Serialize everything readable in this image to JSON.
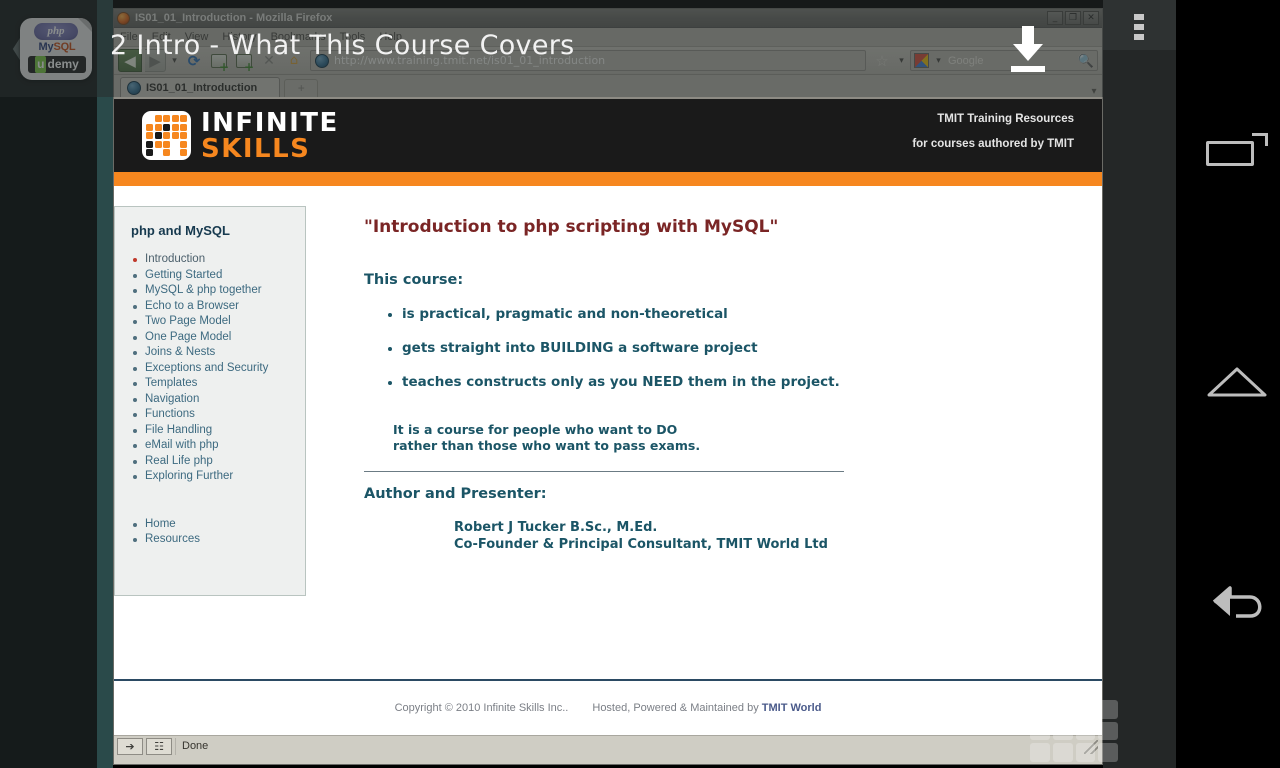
{
  "video_overlay": {
    "title": "2  Intro - What This Course Covers",
    "download_icon": "download-icon",
    "prev_chevron": "chevron-left-icon",
    "thumbnail": {
      "php": "php",
      "mysql_my": "My",
      "mysql_sql": "SQL",
      "udemy_u": "u",
      "udemy_rest": "demy"
    }
  },
  "browser": {
    "window_title": "IS01_01_Introduction - Mozilla Firefox",
    "window_buttons": {
      "minimize": "_",
      "maximize": "❐",
      "close": "✕"
    },
    "menu": [
      "File",
      "Edit",
      "View",
      "History",
      "Bookmarks",
      "Tools",
      "Help"
    ],
    "toolbar": {
      "back": "◀",
      "forward": "▶",
      "history_dropdown": "▾",
      "reload": "⟳",
      "newtab_icon": "new-page-icon",
      "add_icon": "add-page-icon",
      "stop": "✕",
      "home": "⌂",
      "bookmark_star": "☆",
      "bookmark_dropdown": "▾",
      "search_engine": "Google",
      "search_placeholder": "Google",
      "search_magnifier": "🔍"
    },
    "url": "http://www.training.tmit.net/is01_01_introduction",
    "tab": {
      "label": "IS01_01_Introduction",
      "new_tab": "+",
      "tab_list": "▾"
    },
    "status": {
      "text": "Done",
      "icon1": "pointer-icon",
      "icon2": "ruler-icon"
    }
  },
  "page": {
    "logo": {
      "line1": "INFINITE",
      "line2": "SKILLS"
    },
    "header_right": [
      "TMIT Training Resources",
      "for courses authored by TMIT"
    ],
    "sidebar": {
      "title": "php and MySQL",
      "items": [
        "Introduction",
        "Getting Started",
        "MySQL & php together",
        "Echo to a Browser",
        "Two Page Model",
        "One Page Model",
        "Joins & Nests",
        "Exceptions and Security",
        "Templates",
        "Navigation",
        "Functions",
        "File Handling",
        "eMail with php",
        "Real Life php",
        "Exploring Further"
      ],
      "active_index": 0,
      "links": [
        "Home",
        "Resources"
      ]
    },
    "main": {
      "title": "\"Introduction to php scripting with MySQL\"",
      "subtitle": "This course:",
      "bullets": [
        "is practical, pragmatic and non-theoretical",
        "gets straight into BUILDING a software project",
        "teaches constructs only as you NEED them in the project."
      ],
      "note_line1": "It is a course for people who want to DO",
      "note_line2": "rather than those who want to pass exams.",
      "author_heading": "Author and Presenter:",
      "author_line1": "Robert J Tucker    B.Sc., M.Ed.",
      "author_line2": "Co-Founder & Principal Consultant, TMIT World Ltd"
    },
    "footer": {
      "copyright": "Copyright © 2010   Infinite Skills Inc..",
      "hosted_prefix": "Hosted, Powered & Maintained by ",
      "hosted_brand": "TMIT World"
    }
  },
  "android_nav": {
    "overflow": "overflow-menu-icon",
    "recents": "recents-icon",
    "home": "home-icon",
    "back": "back-icon"
  },
  "colors": {
    "accent_orange": "#f6871f",
    "header_black": "#1a1a1a",
    "title_red": "#7a2525",
    "body_teal": "#1b5566",
    "active_bullet": "#c0392b"
  }
}
